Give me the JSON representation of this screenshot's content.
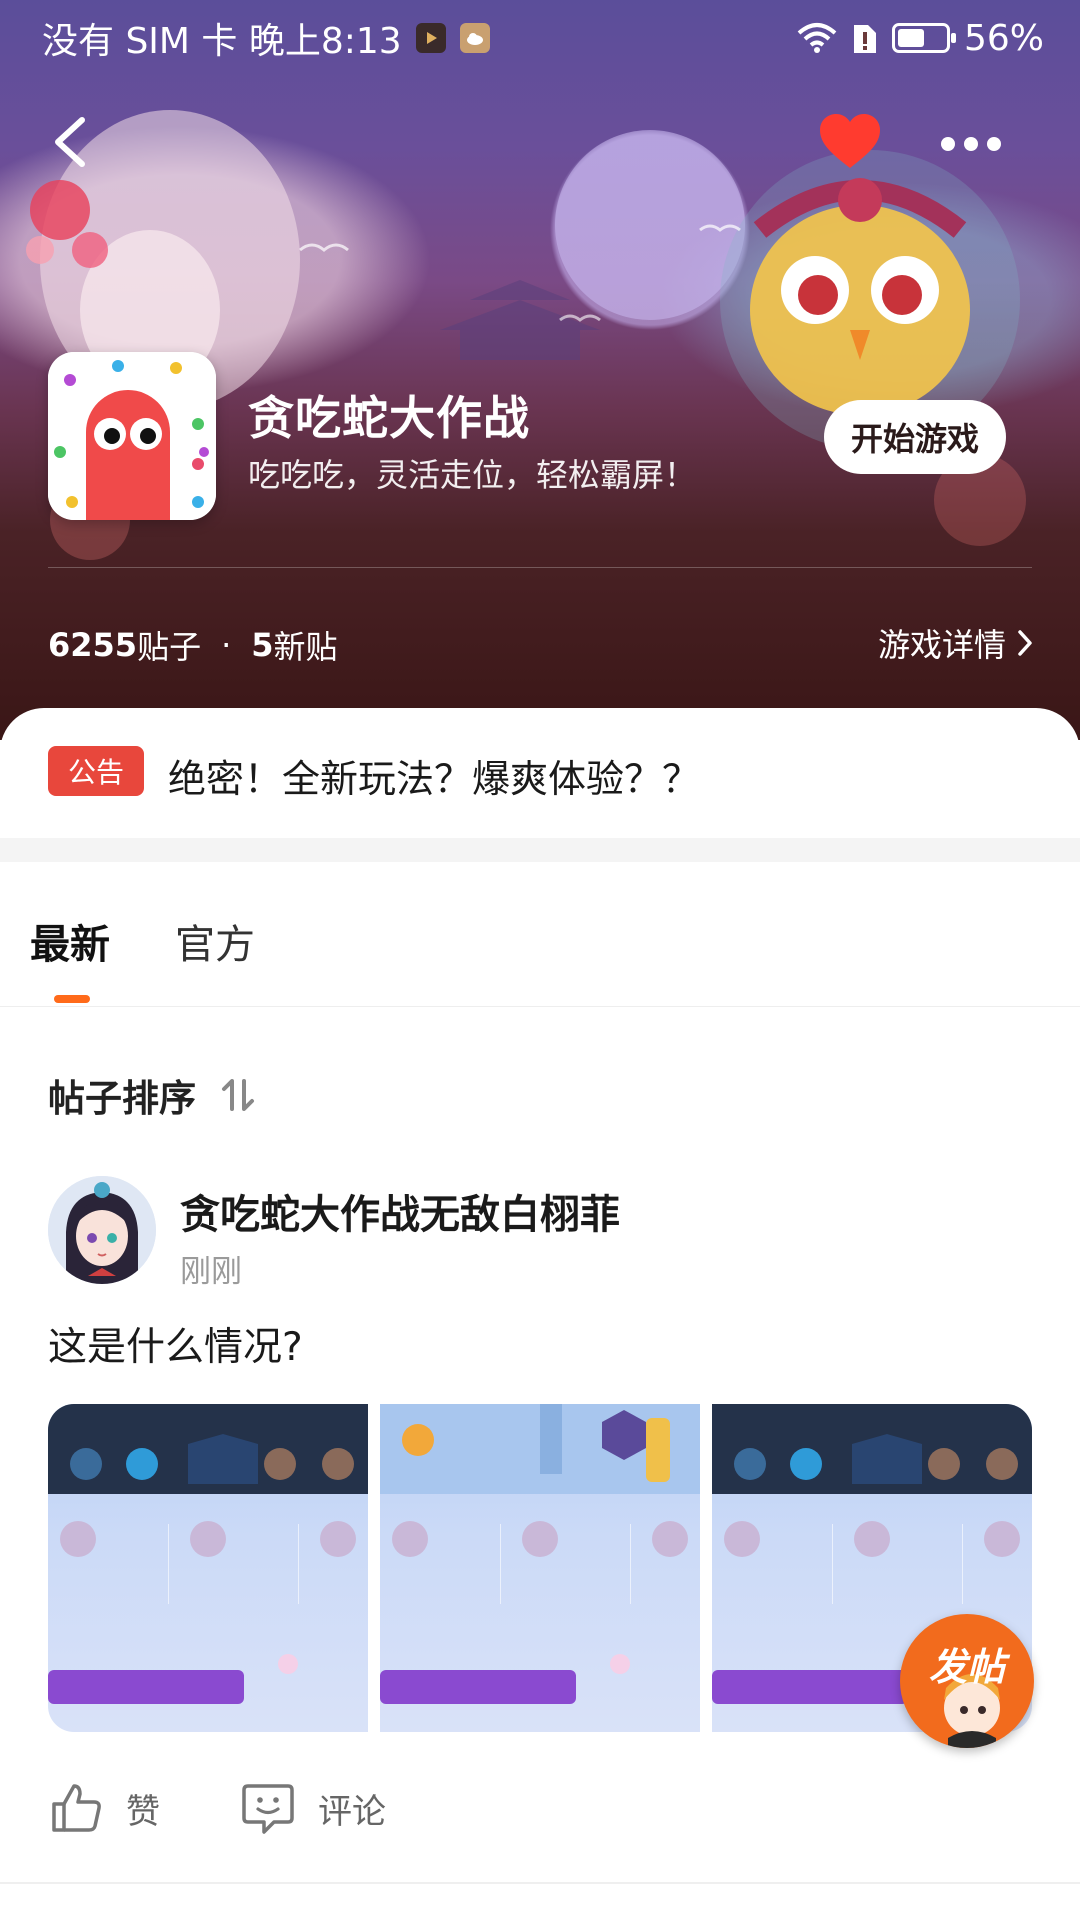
{
  "status_bar": {
    "left_text": "没有 SIM 卡 晚上8:13",
    "battery_percent": "56%",
    "battery_level": 0.56
  },
  "nav": {
    "back_icon": "chevron-left-icon",
    "favorite_icon": "heart-icon",
    "more_icon": "more-dots-icon",
    "favorite_color": "#ff3b2f"
  },
  "game": {
    "title": "贪吃蛇大作战",
    "subtitle": "吃吃吃，灵活走位，轻松霸屏！",
    "start_button": "开始游戏"
  },
  "stats": {
    "posts_count": "6255",
    "posts_label": "贴子",
    "separator": "·",
    "new_count": "5",
    "new_label": "新贴",
    "details_link": "游戏详情"
  },
  "notice": {
    "tag": "公告",
    "text": "绝密！全新玩法？爆爽体验？？",
    "tag_color": "#e8473c"
  },
  "tabs": [
    {
      "label": "最新",
      "active": true
    },
    {
      "label": "官方",
      "active": false
    }
  ],
  "accent_color": "#ff6a1a",
  "sort": {
    "label": "帖子排序"
  },
  "post": {
    "author": "贪吃蛇大作战无敌白栩菲",
    "time": "刚刚",
    "text": "这是什么情况?",
    "image_count": 3
  },
  "fab": {
    "label": "发帖"
  },
  "actions": {
    "like_label": "赞",
    "comment_label": "评论"
  }
}
